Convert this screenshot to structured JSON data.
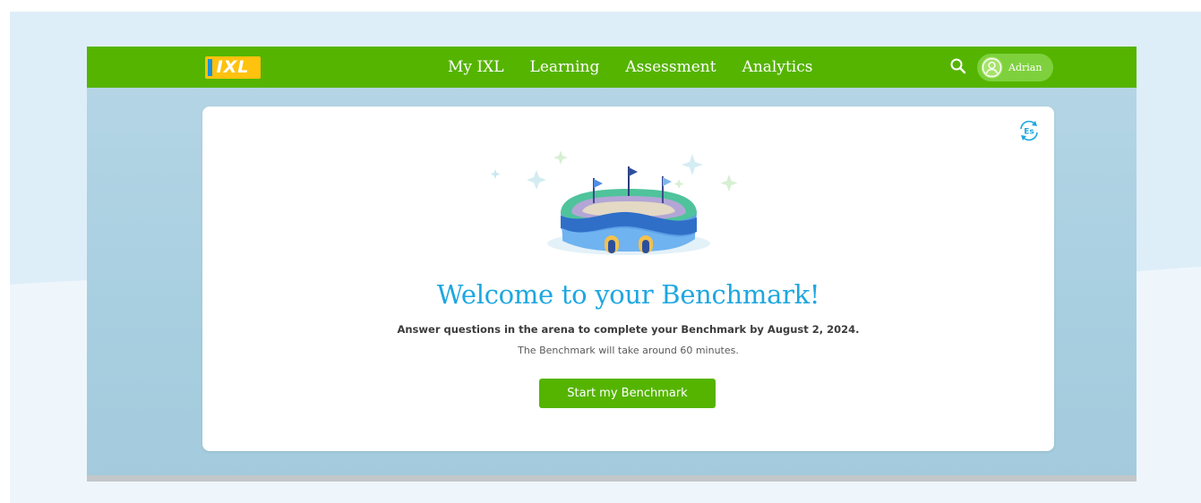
{
  "header": {
    "logo_text": "IXL",
    "nav": [
      "My IXL",
      "Learning",
      "Assessment",
      "Analytics"
    ],
    "user_name": "Adrian"
  },
  "card": {
    "language_toggle": "Es",
    "title": "Welcome to your Benchmark!",
    "subtitle": "Answer questions in the arena to complete your Benchmark by August 2, 2024.",
    "duration": "The Benchmark will take around 60 minutes.",
    "start_button": "Start my Benchmark"
  },
  "icons": {
    "search": "search-icon",
    "avatar": "user-avatar-icon",
    "language": "language-toggle-icon",
    "illustration": "arena-illustration"
  },
  "colors": {
    "nav_green": "#55b400",
    "title_blue": "#1ea7e0",
    "page_bg": "#deeef8",
    "logo_yellow": "#ffc20e"
  }
}
